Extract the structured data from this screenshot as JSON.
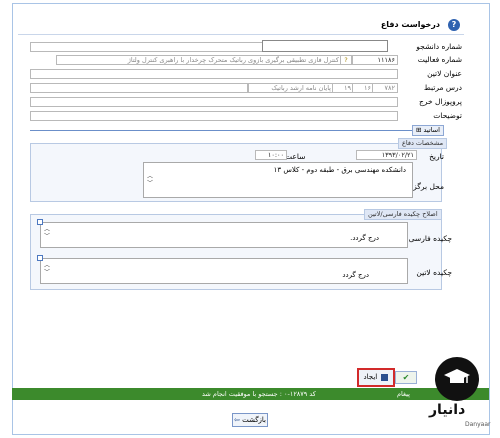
{
  "window": {
    "title": "درخواست دفاع"
  },
  "fields": {
    "student_no_label": "شماره دانشجو",
    "activity_no_label": "شماره فعالیت",
    "activity_no_value": "۱۱۱۸۶",
    "activity_desc": "کنترل فازی تطبیقی برگیری بازوی رباتیک متحرک چرخدار با راهبری کنترل ولتاژ",
    "thesis_title_label": "عنوان لاتین",
    "related_course_label": "درس مرتبط",
    "course_code": "۷۸۲",
    "course_num1": "۱۶",
    "course_num2": "۱۹",
    "course_name": "پایان نامه ارشد رباتیک",
    "external_project_label": "پروپوزال خرج",
    "notes_label": "توضیحات",
    "advisors_tab": "اساتید"
  },
  "defense": {
    "section_title": "مشخصات دفاع",
    "date_label": "تاریخ",
    "date_value": "۱۳۹۳/۰۲/۲۱",
    "time_label": "ساعت",
    "time_value": "۱۰:۰۰",
    "place_label": "محل برگزاری",
    "place_value": "دانشکده مهندسی برق - طبقه دوم - کلاس ۱۳"
  },
  "abstract": {
    "section_title": "اصلاح چکیده فارسی/لاتین",
    "fa_label": "چکیده فارسی",
    "fa_value": "درج گردد.",
    "en_label": "چکیده لاتین",
    "en_value": "درج گردد"
  },
  "buttons": {
    "create_label": "ایجاد",
    "back_label": "بازگشت"
  },
  "status": {
    "message": "کد ۱۲۸۷۹-۰ : جستجو با موفقیت انجام شد",
    "left_label": "پیغام"
  },
  "logo": {
    "name": "دانیار",
    "sub": "Danyaar"
  }
}
